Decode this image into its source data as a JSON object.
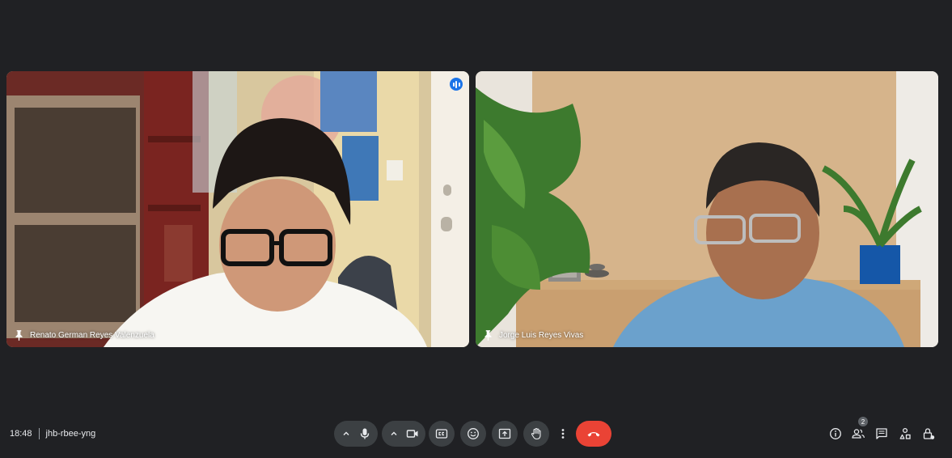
{
  "participants": [
    {
      "name": "Renato German Reyes Valenzuela",
      "pinned": true,
      "speaking": true
    },
    {
      "name": "Jorge Luis Reyes Vivas",
      "pinned": true,
      "speaking": false
    }
  ],
  "meeting": {
    "time": "18:48",
    "code": "jhb-rbee-yng"
  },
  "controls": {
    "people_count": "2"
  },
  "colors": {
    "background": "#202124",
    "control_bg": "#3c4043",
    "leave_red": "#ea4335",
    "speaking_blue": "#1a73e8"
  },
  "icons": [
    "pin-icon",
    "audio-level-icon",
    "chevron-up-icon",
    "mic-icon",
    "camera-icon",
    "captions-icon",
    "emoji-icon",
    "present-icon",
    "raise-hand-icon",
    "more-options-icon",
    "end-call-icon",
    "info-icon",
    "people-icon",
    "chat-icon",
    "activities-icon",
    "host-controls-icon"
  ]
}
